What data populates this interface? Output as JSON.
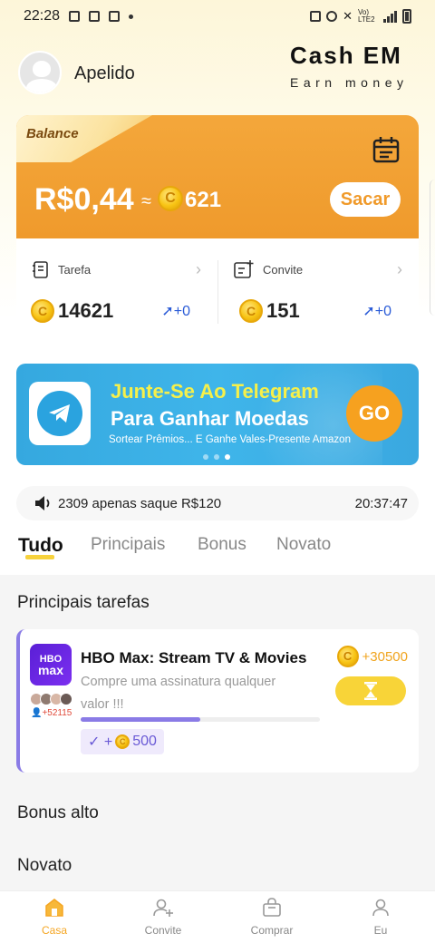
{
  "status_bar": {
    "time": "22:28",
    "network": "Vo) LTE2"
  },
  "header": {
    "nickname": "Apelido",
    "brand_title": "Cash EM",
    "brand_subtitle": "Earn money"
  },
  "balance": {
    "label": "Balance",
    "amount": "R$0,44",
    "approx": "≈",
    "coins": "621",
    "coin_symbol": "C",
    "withdraw_label": "Sacar"
  },
  "stats": [
    {
      "label": "Tarefa",
      "value": "14621",
      "delta": "+0",
      "icon": "task-clipboard-icon"
    },
    {
      "label": "Convite",
      "value": "151",
      "delta": "+0",
      "icon": "invite-add-icon"
    }
  ],
  "banner": {
    "title_line1": "Junte-Se Ao Telegram",
    "title_line2": "Para Ganhar Moedas",
    "subtitle": "Sortear Prêmios... E Ganhe Vales-Presente Amazon",
    "go_label": "GO",
    "slide_index": 3,
    "slide_count": 3
  },
  "notice": {
    "text": "2309 apenas saque R$120",
    "time": "20:37:47"
  },
  "tabs": [
    "Tudo",
    "Principais",
    "Bonus",
    "Novato"
  ],
  "active_tab": "Tudo",
  "sections": {
    "main_tasks_title": "Principais tarefas",
    "high_bonus_title": "Bonus alto",
    "newbie_title": "Novato"
  },
  "task": {
    "logo_line1": "HBO",
    "logo_line2": "max",
    "title": "HBO Max: Stream TV & Movies",
    "description": "Compre uma assinatura qualquer valor !!!",
    "users_count": "+52115",
    "reward": "+30500",
    "bonus_prefix": "✓ +",
    "bonus_value": "500",
    "progress": 0.5
  },
  "bottom_nav": [
    {
      "label": "Casa",
      "icon": "home-icon",
      "active": true
    },
    {
      "label": "Convite",
      "icon": "add-user-icon",
      "active": false
    },
    {
      "label": "Comprar",
      "icon": "shopping-bag-icon",
      "active": false
    },
    {
      "label": "Eu",
      "icon": "profile-icon",
      "active": false
    }
  ],
  "colors": {
    "accent_orange": "#ef9a2c",
    "accent_yellow": "#f8d438",
    "link_blue": "#2a5bd7",
    "purple": "#8a7be6",
    "telegram_blue": "#35a8df"
  }
}
